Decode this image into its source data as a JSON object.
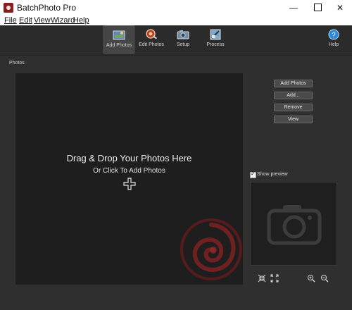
{
  "window": {
    "title": "BatchPhoto Pro"
  },
  "menu": [
    {
      "label": "File",
      "name": "menu-file"
    },
    {
      "label": "Edit",
      "name": "menu-edit"
    },
    {
      "label": "View",
      "name": "menu-view"
    },
    {
      "label": "Wizard",
      "name": "menu-wizard"
    },
    {
      "label": "Help",
      "name": "menu-help"
    }
  ],
  "toolbar": {
    "add_photos": "Add Photos",
    "edit_photos": "Edit Photos",
    "setup": "Setup",
    "process": "Process",
    "help": "Help"
  },
  "photos": {
    "section_label": "Photos",
    "drop_title": "Drag & Drop Your Photos Here",
    "drop_subtitle": "Or Click To Add Photos"
  },
  "side_buttons": {
    "add_photos": "Add Photos",
    "add": "Add...",
    "remove": "Remove",
    "view": "View"
  },
  "preview": {
    "show_preview_label": "Show preview",
    "checked": true
  },
  "colors": {
    "accent": "#9b1f22",
    "background": "#2f2f2f",
    "drop_area": "#1e1e1e"
  }
}
